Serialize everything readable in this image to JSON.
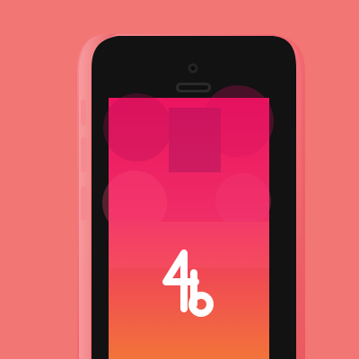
{
  "scene": {
    "subject": "pink-smartphone-mockup",
    "background_color": "#f27673",
    "phone_body_color": "#f46a72",
    "screen_bezel_color": "#111111"
  },
  "screen": {
    "logo_name": "46-app-logo",
    "gradient_top_color": "#ec1460",
    "gradient_bottom_color": "#f2733a",
    "logo_color": "#ffffff"
  }
}
